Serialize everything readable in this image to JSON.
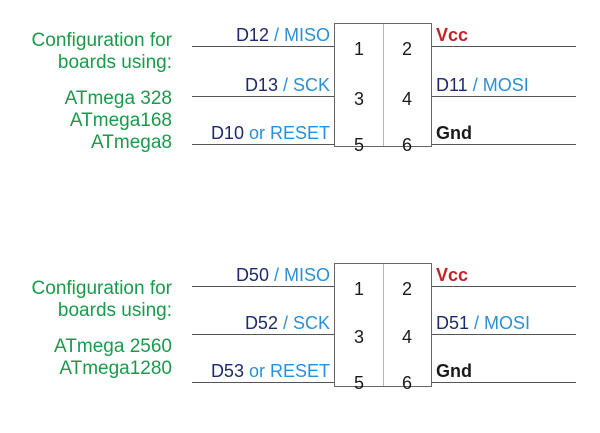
{
  "blocks": [
    {
      "config": {
        "line1": "Configuration for",
        "line2": "boards using:",
        "models": [
          "ATmega 328",
          "ATmega168",
          "ATmega8"
        ]
      },
      "pins": [
        {
          "left_name": "D12",
          "left_sep": " / ",
          "left_alt": "MISO",
          "num_left": "1",
          "num_right": "2",
          "right_name": "",
          "right_sep": "",
          "right_alt": "",
          "right_special": "Vcc"
        },
        {
          "left_name": "D13",
          "left_sep": " / ",
          "left_alt": "SCK",
          "num_left": "3",
          "num_right": "4",
          "right_name": "D11",
          "right_sep": " / ",
          "right_alt": "MOSI",
          "right_special": ""
        },
        {
          "left_name": "D10",
          "left_sep": " or ",
          "left_alt": "RESET",
          "num_left": "5",
          "num_right": "6",
          "right_name": "",
          "right_sep": "",
          "right_alt": "",
          "right_special": "Gnd"
        }
      ]
    },
    {
      "config": {
        "line1": "Configuration for",
        "line2": "boards using:",
        "models": [
          "ATmega 2560",
          "ATmega1280"
        ]
      },
      "pins": [
        {
          "left_name": "D50",
          "left_sep": " / ",
          "left_alt": "MISO",
          "num_left": "1",
          "num_right": "2",
          "right_name": "",
          "right_sep": "",
          "right_alt": "",
          "right_special": "Vcc"
        },
        {
          "left_name": "D52",
          "left_sep": " / ",
          "left_alt": "SCK",
          "num_left": "3",
          "num_right": "4",
          "right_name": "D51",
          "right_sep": " / ",
          "right_alt": "MOSI",
          "right_special": ""
        },
        {
          "left_name": "D53",
          "left_sep": " or ",
          "left_alt": "RESET",
          "num_left": "5",
          "num_right": "6",
          "right_name": "",
          "right_sep": "",
          "right_alt": "",
          "right_special": "Gnd"
        }
      ]
    }
  ],
  "colors": {
    "config_text": "#1a9a4a",
    "pin_name": "#1e2a6e",
    "pin_alt": "#2a8fd6",
    "vcc": "#c0242a",
    "gnd": "#1a1a1a"
  }
}
